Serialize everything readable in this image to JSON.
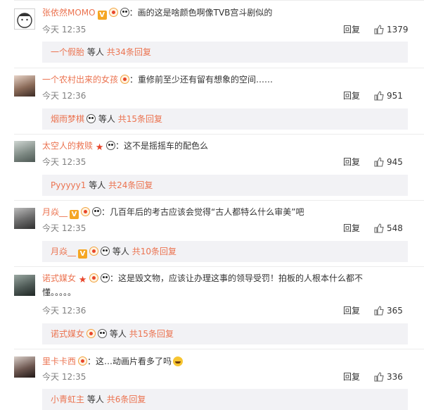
{
  "comments": [
    {
      "name": "张依然MOMO",
      "text": "：画的这是啥颜色啊像TVB宫斗剧似的",
      "time": "今天 12:35",
      "reply": "回复",
      "likes": "1379",
      "sub": {
        "lead": "一个假胎",
        "mid": "等人",
        "tail": "共34条回复"
      }
    },
    {
      "name": "一个农村出来的女孩",
      "text": "：重修前至少还有留有想象的空间……",
      "time": "今天 12:36",
      "reply": "回复",
      "likes": "951",
      "sub": {
        "lead": "烟雨梦棋",
        "mid": "等人",
        "tail": "共15条回复"
      }
    },
    {
      "name": "太空人的救赎",
      "text": "：这不是摇摇车的配色么",
      "time": "今天 12:35",
      "reply": "回复",
      "likes": "945",
      "sub": {
        "lead": "Pyyyyy1",
        "mid": "等人",
        "tail": "共24条回复"
      }
    },
    {
      "name": "月焱__",
      "text": "：几百年后的考古应该会觉得“古人都特么什么审美”吧",
      "time": "今天 12:35",
      "reply": "回复",
      "likes": "548",
      "sub": {
        "lead": "月焱__",
        "mid": "等人",
        "tail": "共10条回复"
      }
    },
    {
      "name": "诺式媒女",
      "text": "：这是毁文物，应该让办理这事的领导受罚！拍板的人根本什么都不懂。。。。。",
      "time": "今天 12:36",
      "reply": "回复",
      "likes": "365",
      "sub": {
        "lead": "诺式媒女",
        "mid": "等人",
        "tail": "共15条回复"
      }
    },
    {
      "name": "里卡卡西",
      "text": "：这…动画片看多了吗",
      "time": "今天 12:35",
      "reply": "回复",
      "likes": "336",
      "sub": {
        "lead": "小青虹主",
        "mid": "等人",
        "tail": "共6条回复"
      }
    }
  ]
}
